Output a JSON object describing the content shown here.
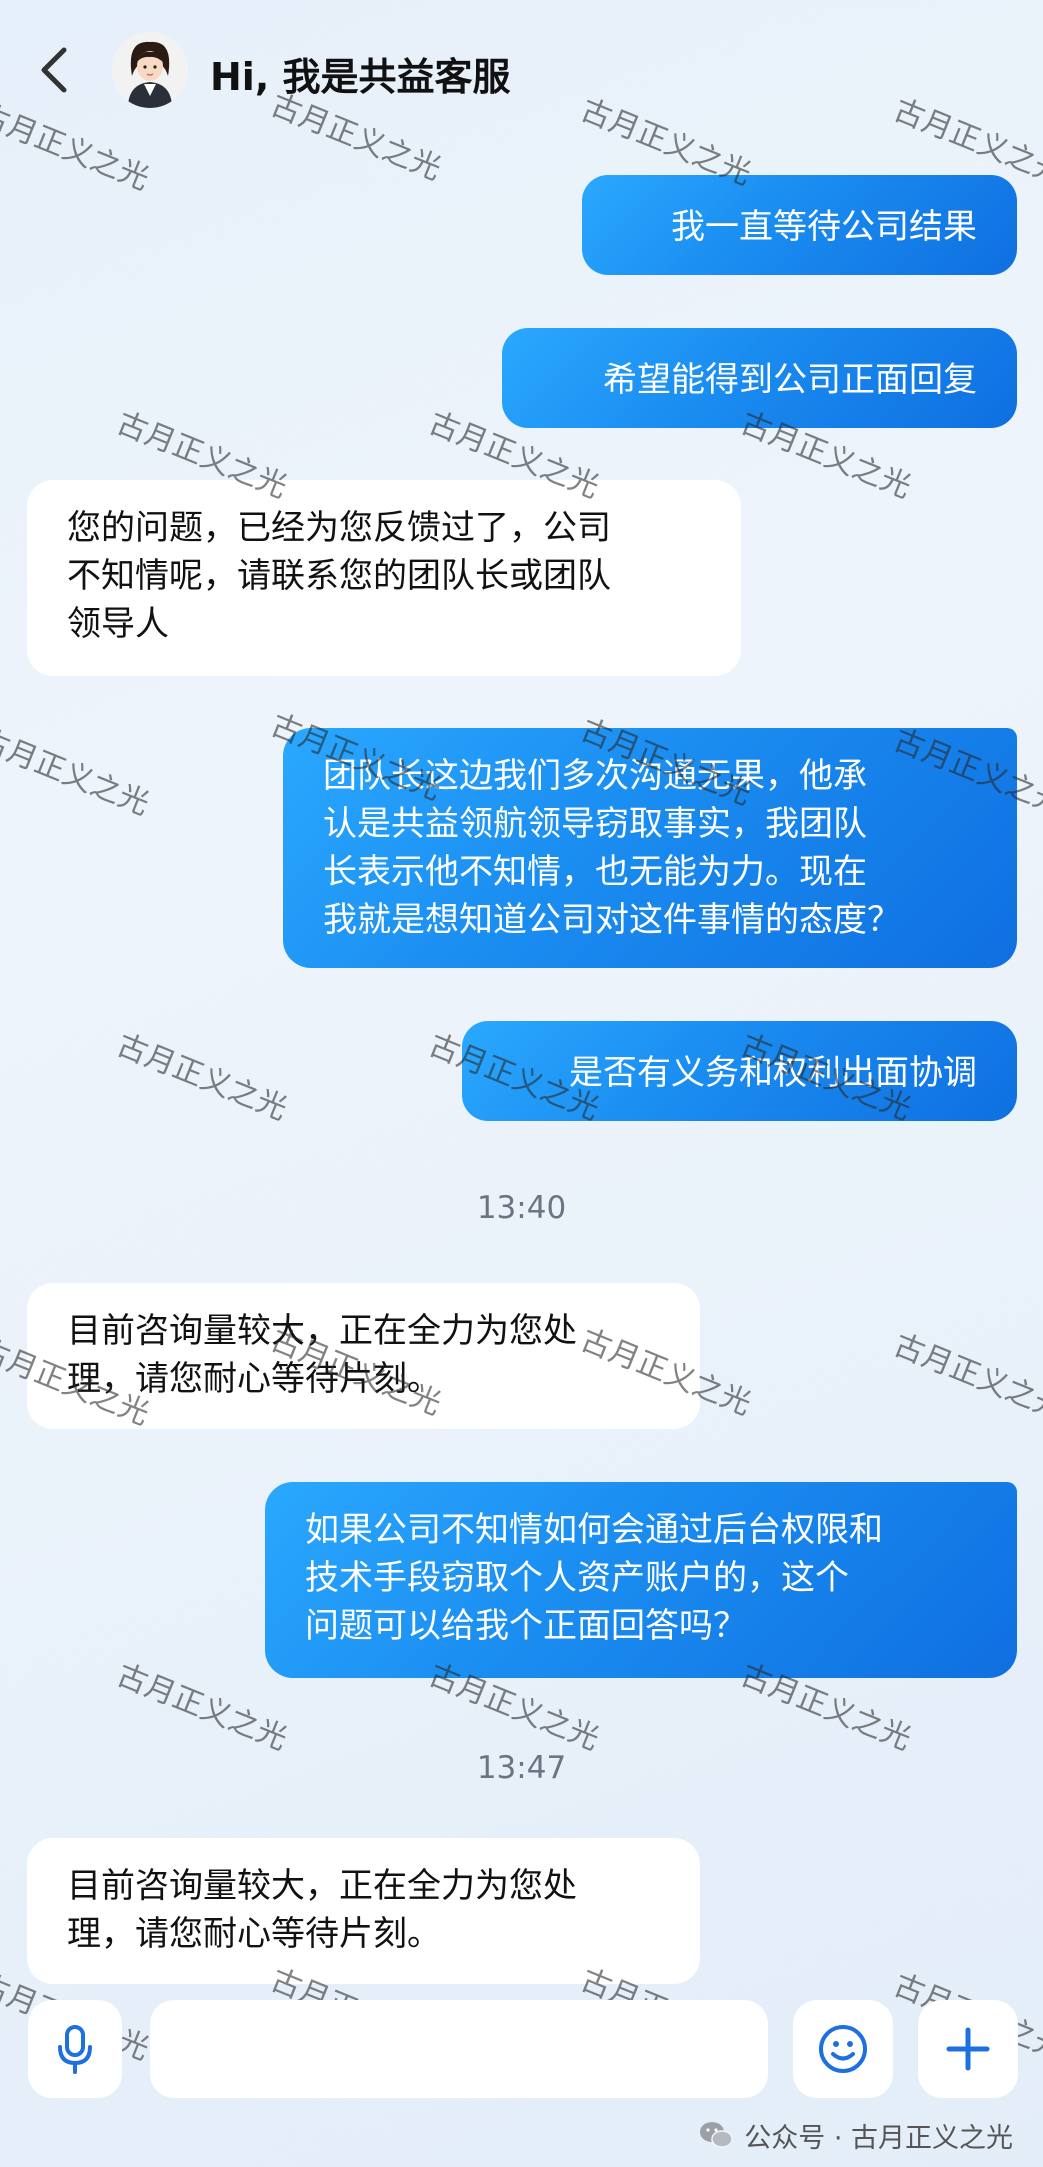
{
  "header": {
    "back_icon": "chevron-left-icon",
    "avatar_icon": "agent-avatar",
    "title": "Hi, 我是共益客服"
  },
  "messages": [
    {
      "side": "out",
      "lines": [
        "我一直等待公司结果"
      ]
    },
    {
      "side": "out",
      "lines": [
        "希望能得到公司正面回复"
      ]
    },
    {
      "side": "in",
      "lines": [
        "您的问题，已经为您反馈过了，公司",
        "不知情呢，请联系您的团队长或团队",
        "领导人"
      ]
    },
    {
      "side": "out",
      "lines": [
        "团队长这边我们多次沟通无果，他承",
        "认是共益领航领导窃取事实，我团队",
        "长表示他不知情，也无能为力。现在",
        "我就是想知道公司对这件事情的态度？"
      ]
    },
    {
      "side": "out",
      "lines": [
        "是否有义务和权利出面协调"
      ]
    },
    {
      "timestamp": "13:40"
    },
    {
      "side": "in",
      "lines": [
        "目前咨询量较大，正在全力为您处",
        "理，请您耐心等待片刻。"
      ]
    },
    {
      "side": "out",
      "lines": [
        "如果公司不知情如何会通过后台权限和",
        "技术手段窃取个人资产账户的，这个",
        "问题可以给我个正面回答吗？"
      ]
    },
    {
      "timestamp": "13:47"
    },
    {
      "side": "in",
      "lines": [
        "目前咨询量较大，正在全力为您处",
        "理，请您耐心等待片刻。"
      ]
    }
  ],
  "watermark": {
    "text": "古月正义之光"
  },
  "input_bar": {
    "mic_icon": "microphone-icon",
    "input_value": "",
    "emoji_icon": "smiley-icon",
    "plus_icon": "plus-icon"
  },
  "footer": {
    "icon": "wechat-icon",
    "text": "公众号 · 古月正义之光"
  },
  "colors": {
    "out_bubble": "#1a8cf0",
    "in_bubble": "#ffffff",
    "accent": "#1e7be6",
    "timestamp": "#6b7480"
  }
}
